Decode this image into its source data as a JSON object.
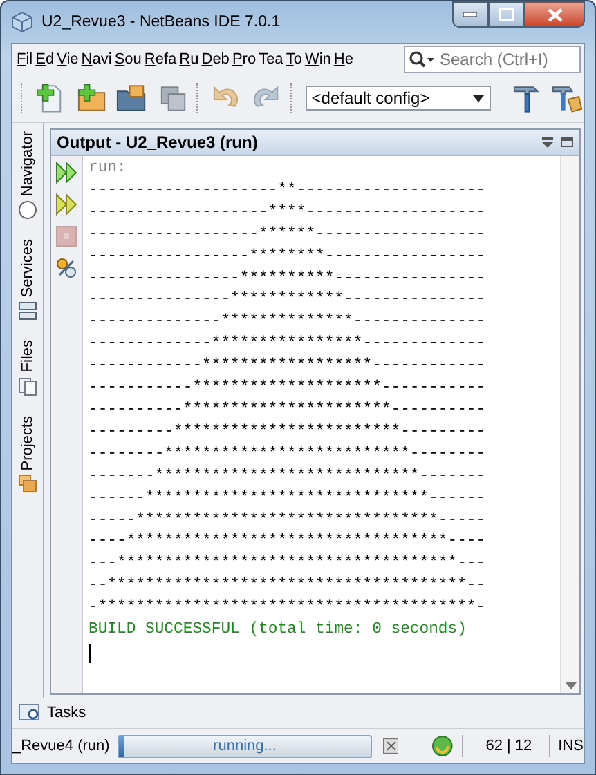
{
  "window": {
    "title": "U2_Revue3 - NetBeans IDE 7.0.1"
  },
  "menu": [
    {
      "label": "Fil",
      "mnemonic": true
    },
    {
      "label": "Ed",
      "mnemonic": true
    },
    {
      "label": "Vie",
      "mnemonic": true
    },
    {
      "label": "Navi",
      "mnemonic": true
    },
    {
      "label": "Sou",
      "mnemonic": true
    },
    {
      "label": "Refa",
      "mnemonic": true
    },
    {
      "label": "Ru",
      "mnemonic": true
    },
    {
      "label": "Deb",
      "mnemonic": true
    },
    {
      "label": "Pro",
      "mnemonic": true
    },
    {
      "label": "Tea",
      "mnemonic": false
    },
    {
      "label": "To",
      "mnemonic": true
    },
    {
      "label": "Win",
      "mnemonic": true
    },
    {
      "label": "He",
      "mnemonic": true
    }
  ],
  "search": {
    "placeholder": "Search (Ctrl+I)"
  },
  "toolbar": {
    "config": "<default config>"
  },
  "side_tabs": [
    "Navigator",
    "Services",
    "Files",
    "Projects"
  ],
  "output": {
    "title": "Output - U2_Revue3 (run)",
    "lines": [
      {
        "kind": "info",
        "text": "run:"
      },
      {
        "kind": "plain",
        "text": "--------------------**--------------------"
      },
      {
        "kind": "plain",
        "text": "-------------------****-------------------"
      },
      {
        "kind": "plain",
        "text": "------------------******------------------"
      },
      {
        "kind": "plain",
        "text": "-----------------********-----------------"
      },
      {
        "kind": "plain",
        "text": "----------------**********----------------"
      },
      {
        "kind": "plain",
        "text": "---------------************---------------"
      },
      {
        "kind": "plain",
        "text": "--------------**************--------------"
      },
      {
        "kind": "plain",
        "text": "-------------****************-------------"
      },
      {
        "kind": "plain",
        "text": "------------******************------------"
      },
      {
        "kind": "plain",
        "text": "-----------********************-----------"
      },
      {
        "kind": "plain",
        "text": "----------**********************----------"
      },
      {
        "kind": "plain",
        "text": "---------************************---------"
      },
      {
        "kind": "plain",
        "text": "--------**************************--------"
      },
      {
        "kind": "plain",
        "text": "-------****************************-------"
      },
      {
        "kind": "plain",
        "text": "------******************************------"
      },
      {
        "kind": "plain",
        "text": "-----********************************-----"
      },
      {
        "kind": "plain",
        "text": "----**********************************----"
      },
      {
        "kind": "plain",
        "text": "---************************************---"
      },
      {
        "kind": "plain",
        "text": "--**************************************--"
      },
      {
        "kind": "plain",
        "text": "-****************************************-"
      },
      {
        "kind": "success",
        "text": "BUILD SUCCESSFUL (total time: 0 seconds)"
      }
    ]
  },
  "bottom_tabs": [
    "Tasks"
  ],
  "status_bar": {
    "task": "_Revue4 (run)",
    "progress": "running...",
    "level": 0.02,
    "position": "62 | 12",
    "mode": "INS"
  }
}
